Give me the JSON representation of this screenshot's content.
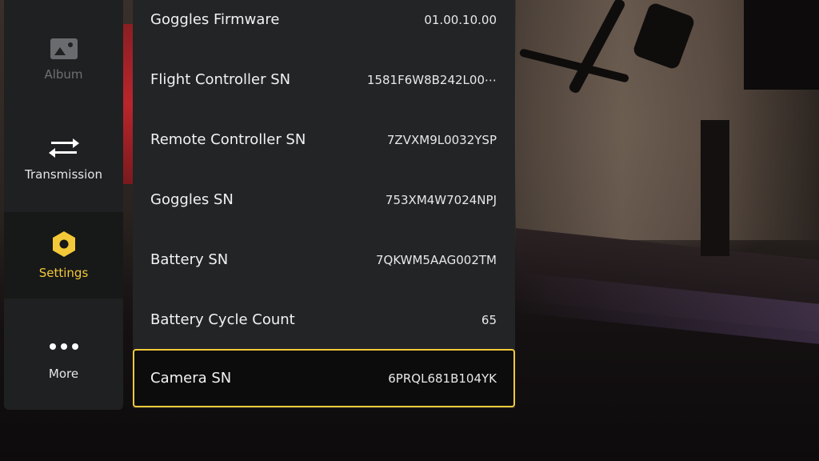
{
  "nav": {
    "items": [
      {
        "label": "Album",
        "icon": "image-icon",
        "state": "disabled"
      },
      {
        "label": "Transmission",
        "icon": "transfer-arrows-icon",
        "state": "normal"
      },
      {
        "label": "Settings",
        "icon": "hexagon-gear-icon",
        "state": "active"
      },
      {
        "label": "More",
        "icon": "ellipsis-icon",
        "state": "normal"
      }
    ]
  },
  "info_list": {
    "rows": [
      {
        "label": "Goggles Firmware",
        "value": "01.00.10.00"
      },
      {
        "label": "Flight Controller SN",
        "value": "1581F6W8B242L00⋯"
      },
      {
        "label": "Remote Controller SN",
        "value": "7ZVXM9L0032YSP"
      },
      {
        "label": "Goggles SN",
        "value": "753XM4W7024NPJ"
      },
      {
        "label": "Battery SN",
        "value": "7QKWM5AAG002TM"
      },
      {
        "label": "Battery Cycle Count",
        "value": "65"
      },
      {
        "label": "Camera SN",
        "value": "6PRQL681B104YK"
      }
    ],
    "selected_index": 6
  },
  "colors": {
    "accent": "#f3c93a",
    "panel_bg": "#232426",
    "rail_bg": "#1f2021",
    "text": "#f2f2f2",
    "disabled_text": "#6f7073"
  }
}
